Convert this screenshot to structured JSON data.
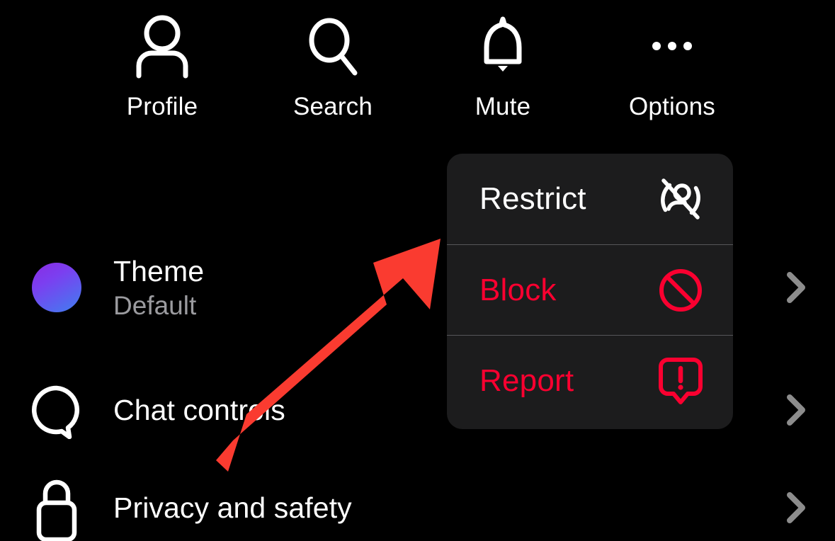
{
  "theme": {
    "background": "#000000",
    "menu_background": "#1c1c1d",
    "menu_divider": "#565659",
    "danger_color": "#fa0030",
    "text_primary": "#ffffff",
    "text_secondary": "#9b9b9f",
    "chevron_color": "#8c8c8c",
    "annotation_color": "#fa3b30",
    "theme_swatch_gradient_from": "#8a2be2",
    "theme_swatch_gradient_to": "#3f7ff0"
  },
  "top_actions": [
    {
      "label": "Profile",
      "icon": "person-icon"
    },
    {
      "label": "Search",
      "icon": "search-icon"
    },
    {
      "label": "Mute",
      "icon": "bell-icon"
    },
    {
      "label": "Options",
      "icon": "ellipsis-icon"
    }
  ],
  "settings": [
    {
      "title": "Theme",
      "subtitle": "Default",
      "icon": "theme-color-swatch",
      "chevron": "chevron-right-icon"
    },
    {
      "title": "Chat controls",
      "subtitle": "",
      "icon": "chat-bubble-icon",
      "chevron": "chevron-right-icon"
    },
    {
      "title": "Privacy and safety",
      "subtitle": "",
      "icon": "lock-icon",
      "chevron": "chevron-right-icon"
    }
  ],
  "context_menu": {
    "items": [
      {
        "label": "Restrict",
        "icon": "restrict-person-slash-icon",
        "style": "neutral"
      },
      {
        "label": "Block",
        "icon": "block-circle-slash-icon",
        "style": "danger"
      },
      {
        "label": "Report",
        "icon": "report-exclamation-bubble-icon",
        "style": "danger"
      }
    ]
  },
  "annotation": {
    "type": "arrow",
    "points_to": "Restrict",
    "color": "#fa3b30"
  }
}
